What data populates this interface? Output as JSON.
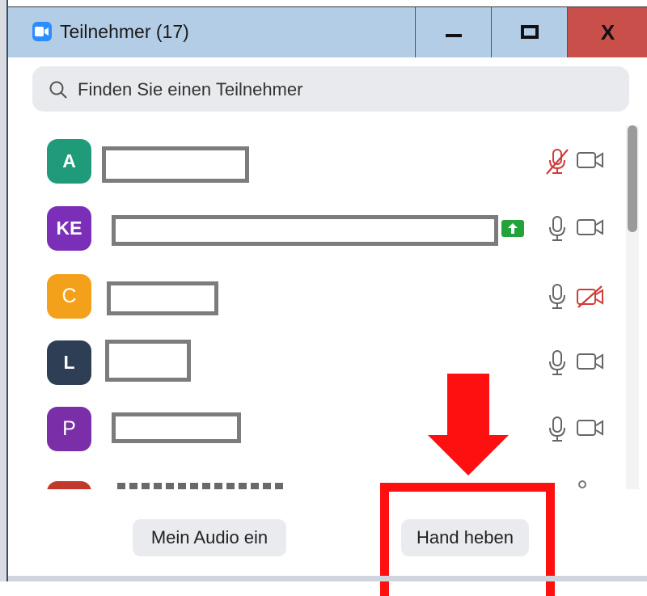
{
  "window": {
    "title": "Teilnehmer (17)",
    "close_label": "X"
  },
  "search": {
    "placeholder": "Finden Sie einen Teilnehmer"
  },
  "colors": {
    "accent": "#2d8cff",
    "muted_red": "#d03c3c",
    "raise_green": "#23a23a",
    "annotation_red": "#ff1010"
  },
  "participants": [
    {
      "initials": "A",
      "avatar_color": "#1f9b7a",
      "mic": "muted",
      "video": "off-available",
      "name_redacted": true
    },
    {
      "initials": "KE",
      "avatar_color": "#7b2fb8",
      "mic": "on",
      "video": "off-available",
      "name_redacted": true,
      "badge": "raise-hand-up-arrow-icon"
    },
    {
      "initials": "C",
      "avatar_color": "#f3a01b",
      "mic": "on",
      "video": "blocked",
      "name_redacted": true
    },
    {
      "initials": "L",
      "avatar_color": "#2e3e55",
      "mic": "on",
      "video": "off-available",
      "name_redacted": true
    },
    {
      "initials": "P",
      "avatar_color": "#7a2fa8",
      "mic": "on",
      "video": "off-available",
      "name_redacted": true
    }
  ],
  "footer": {
    "audio_button": "Mein Audio ein",
    "hand_button": "Hand heben"
  },
  "annotation": {
    "arrow": "down-arrow-icon",
    "highlight": "highlight-box"
  }
}
